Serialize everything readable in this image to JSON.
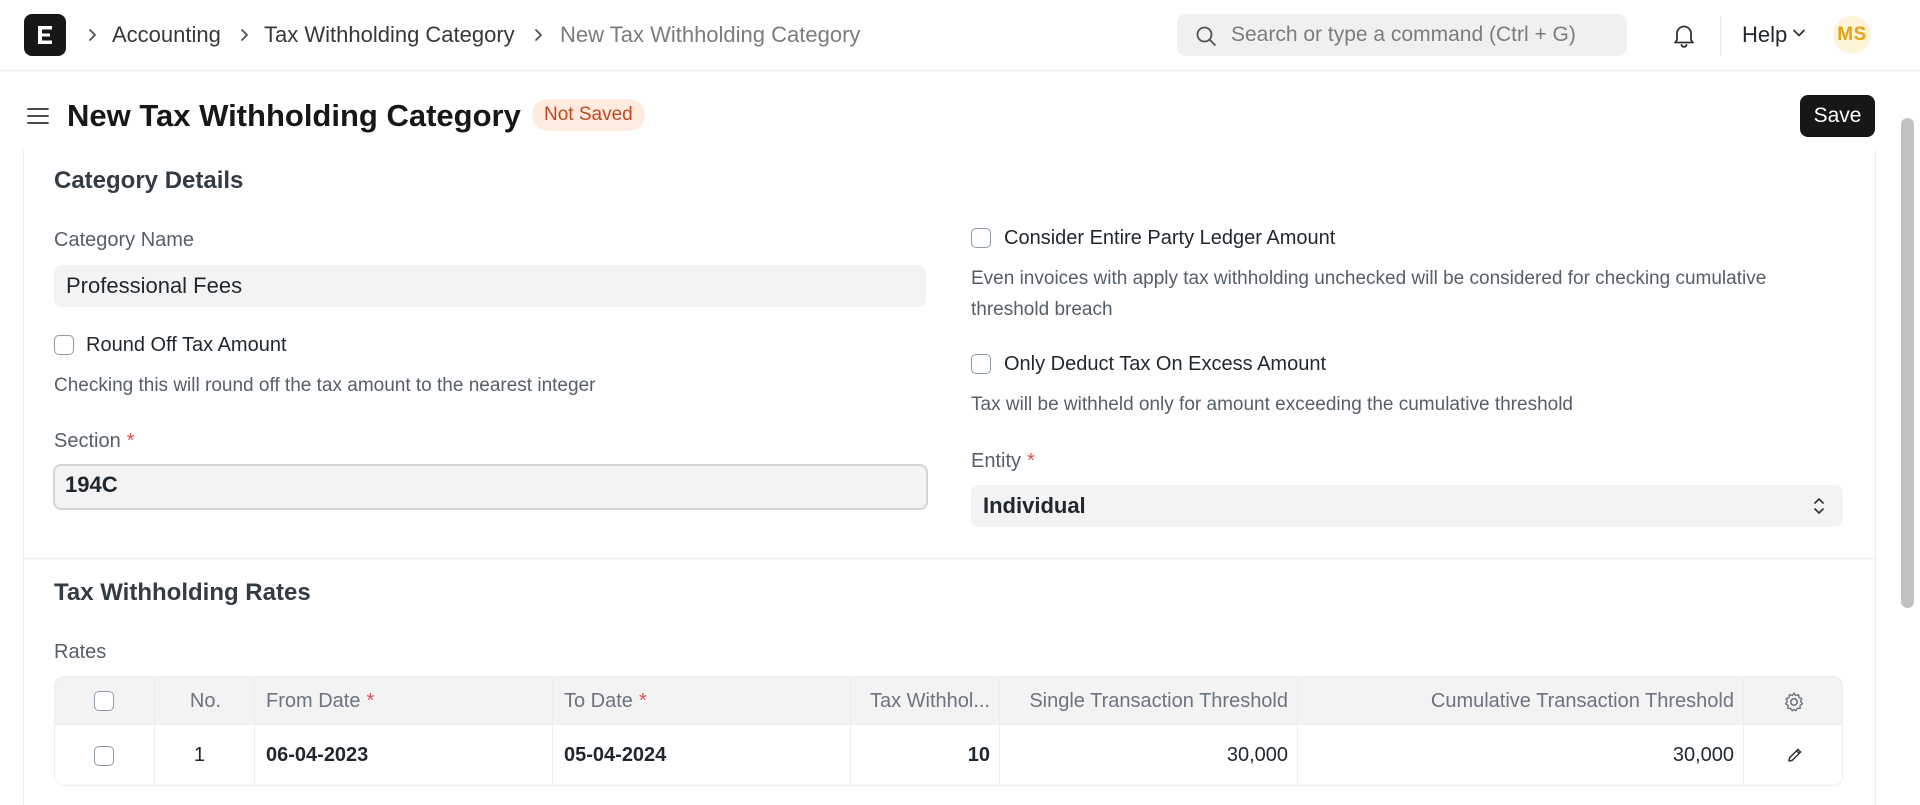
{
  "navbar": {
    "breadcrumbs": [
      "Accounting",
      "Tax Withholding Category",
      "New Tax Withholding Category"
    ],
    "search_placeholder": "Search or type a command (Ctrl + G)",
    "help_label": "Help",
    "avatar_initials": "MS"
  },
  "page": {
    "title": "New Tax Withholding Category",
    "status": "Not Saved",
    "save_label": "Save"
  },
  "category_details": {
    "section_title": "Category Details",
    "category_name_label": "Category Name",
    "category_name_value": "Professional Fees",
    "round_off_label": "Round Off Tax Amount",
    "round_off_help": "Checking this will round off the tax amount to the nearest integer",
    "section_label": "Section",
    "section_value": "194C",
    "consider_ledger_label": "Consider Entire Party Ledger Amount",
    "consider_ledger_help": "Even invoices with apply tax withholding unchecked will be considered for checking cumulative threshold breach",
    "only_deduct_label": "Only Deduct Tax On Excess Amount",
    "only_deduct_help": "Tax will be withheld only for amount exceeding the cumulative threshold",
    "entity_label": "Entity",
    "entity_value": "Individual"
  },
  "rates": {
    "section_title": "Tax Withholding Rates",
    "table_label": "Rates",
    "columns": [
      "No.",
      "From Date",
      "To Date",
      "Tax Withhol...",
      "Single Transaction Threshold",
      "Cumulative Transaction Threshold"
    ],
    "rows": [
      {
        "no": "1",
        "from_date": "06-04-2023",
        "to_date": "05-04-2024",
        "rate": "10",
        "single": "30,000",
        "cumulative": "30,000"
      }
    ]
  },
  "icons": [
    "app-logo-icon",
    "chevron-right-icon",
    "search-icon",
    "bell-icon",
    "chevron-down-icon",
    "hamburger-icon",
    "select-arrows-icon",
    "gear-icon",
    "pencil-icon"
  ],
  "colors": {
    "status_badge_bg": "#fdebe0",
    "status_badge_text": "#c0491f",
    "primary_button": "#171717",
    "required": "#e24c4c"
  }
}
